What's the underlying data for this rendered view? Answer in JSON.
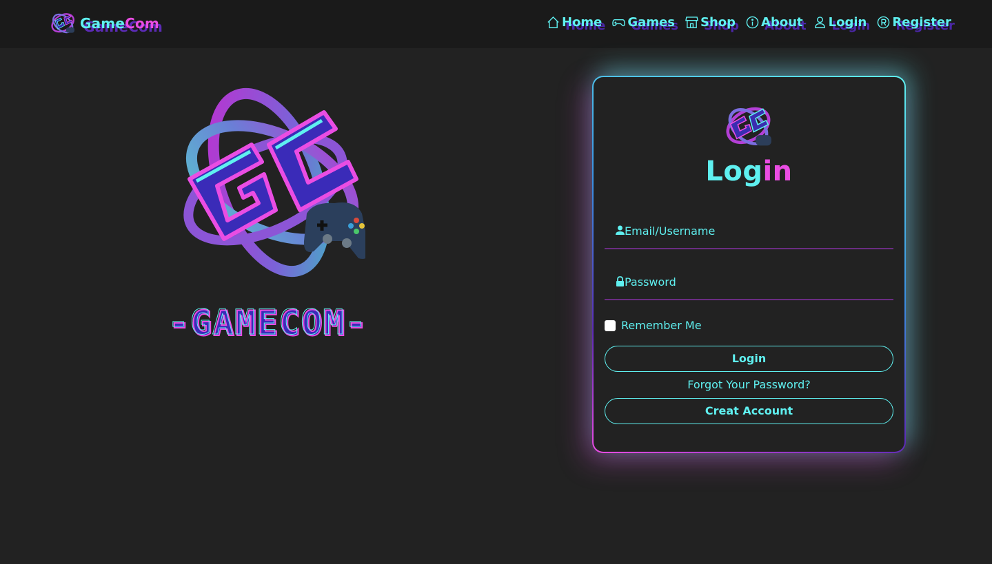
{
  "brand": {
    "name_part1": "Game",
    "name_part2": "Com"
  },
  "nav": {
    "items": [
      {
        "label": "Home",
        "icon": "home-icon"
      },
      {
        "label": "Games",
        "icon": "gamepad-icon"
      },
      {
        "label": "Shop",
        "icon": "shop-icon"
      },
      {
        "label": "About",
        "icon": "info-icon"
      },
      {
        "label": "Login",
        "icon": "user-icon"
      },
      {
        "label": "Register",
        "icon": "registered-icon"
      }
    ]
  },
  "hero": {
    "wordmark": "-GAMECOM-"
  },
  "login": {
    "title_part1": "Log",
    "title_part2": "in",
    "username_placeholder": "Email/Username",
    "password_placeholder": "Password",
    "remember_label": "Remember Me",
    "login_button": "Login",
    "forgot_link": "Forgot Your Password?",
    "create_button": "Creat Account"
  },
  "colors": {
    "cyan": "#5ff0f0",
    "magenta": "#ea4de3",
    "purple": "#5b2bb5",
    "background": "#222222",
    "navbar": "#1a1a1a"
  }
}
